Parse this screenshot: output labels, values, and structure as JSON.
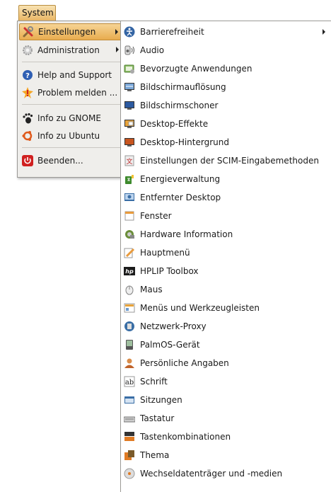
{
  "panel": {
    "menu_label": "System"
  },
  "main_menu": {
    "items": [
      {
        "label": "Einstellungen",
        "icon": "preferences-tools-icon"
      },
      {
        "label": "Administration",
        "icon": "administration-gear-icon"
      },
      {
        "label": "Help and Support",
        "icon": "help-icon"
      },
      {
        "label": "Problem melden ...",
        "icon": "bug-report-icon"
      },
      {
        "label": "Info zu GNOME",
        "icon": "gnome-foot-icon"
      },
      {
        "label": "Info zu Ubuntu",
        "icon": "ubuntu-logo-icon"
      },
      {
        "label": "Beenden...",
        "icon": "power-icon"
      }
    ]
  },
  "submenu": {
    "items": [
      {
        "label": "Barrierefreiheit",
        "icon": "accessibility-icon"
      },
      {
        "label": "Audio",
        "icon": "audio-speaker-icon"
      },
      {
        "label": "Bevorzugte Anwendungen",
        "icon": "preferred-applications-icon"
      },
      {
        "label": "Bildschirmauflösung",
        "icon": "display-resolution-icon"
      },
      {
        "label": "Bildschirmschoner",
        "icon": "screensaver-icon"
      },
      {
        "label": "Desktop-Effekte",
        "icon": "desktop-effects-icon"
      },
      {
        "label": "Desktop-Hintergrund",
        "icon": "desktop-background-icon"
      },
      {
        "label": "Einstellungen der SCIM-Eingabemethoden",
        "icon": "scim-input-icon"
      },
      {
        "label": "Energieverwaltung",
        "icon": "power-management-icon"
      },
      {
        "label": "Entfernter Desktop",
        "icon": "remote-desktop-icon"
      },
      {
        "label": "Fenster",
        "icon": "window-icon"
      },
      {
        "label": "Hardware Information",
        "icon": "hardware-info-icon"
      },
      {
        "label": "Hauptmenü",
        "icon": "main-menu-editor-icon"
      },
      {
        "label": "HPLIP Toolbox",
        "icon": "hp-logo-icon"
      },
      {
        "label": "Maus",
        "icon": "mouse-icon"
      },
      {
        "label": "Menüs und Werkzeugleisten",
        "icon": "menus-toolbars-icon"
      },
      {
        "label": "Netzwerk-Proxy",
        "icon": "network-proxy-icon"
      },
      {
        "label": "PalmOS-Gerät",
        "icon": "palm-device-icon"
      },
      {
        "label": "Persönliche Angaben",
        "icon": "personal-info-icon"
      },
      {
        "label": "Schrift",
        "icon": "font-icon"
      },
      {
        "label": "Sitzungen",
        "icon": "sessions-icon"
      },
      {
        "label": "Tastatur",
        "icon": "keyboard-icon"
      },
      {
        "label": "Tastenkombinationen",
        "icon": "keyboard-shortcuts-icon"
      },
      {
        "label": "Thema",
        "icon": "theme-icon"
      },
      {
        "label": "Wechseldatenträger und -medien",
        "icon": "removable-media-icon"
      }
    ]
  },
  "colors": {
    "highlight_top": "#f6d495",
    "highlight_bottom": "#e8ac4e",
    "menu_background": "#efeeeb"
  }
}
